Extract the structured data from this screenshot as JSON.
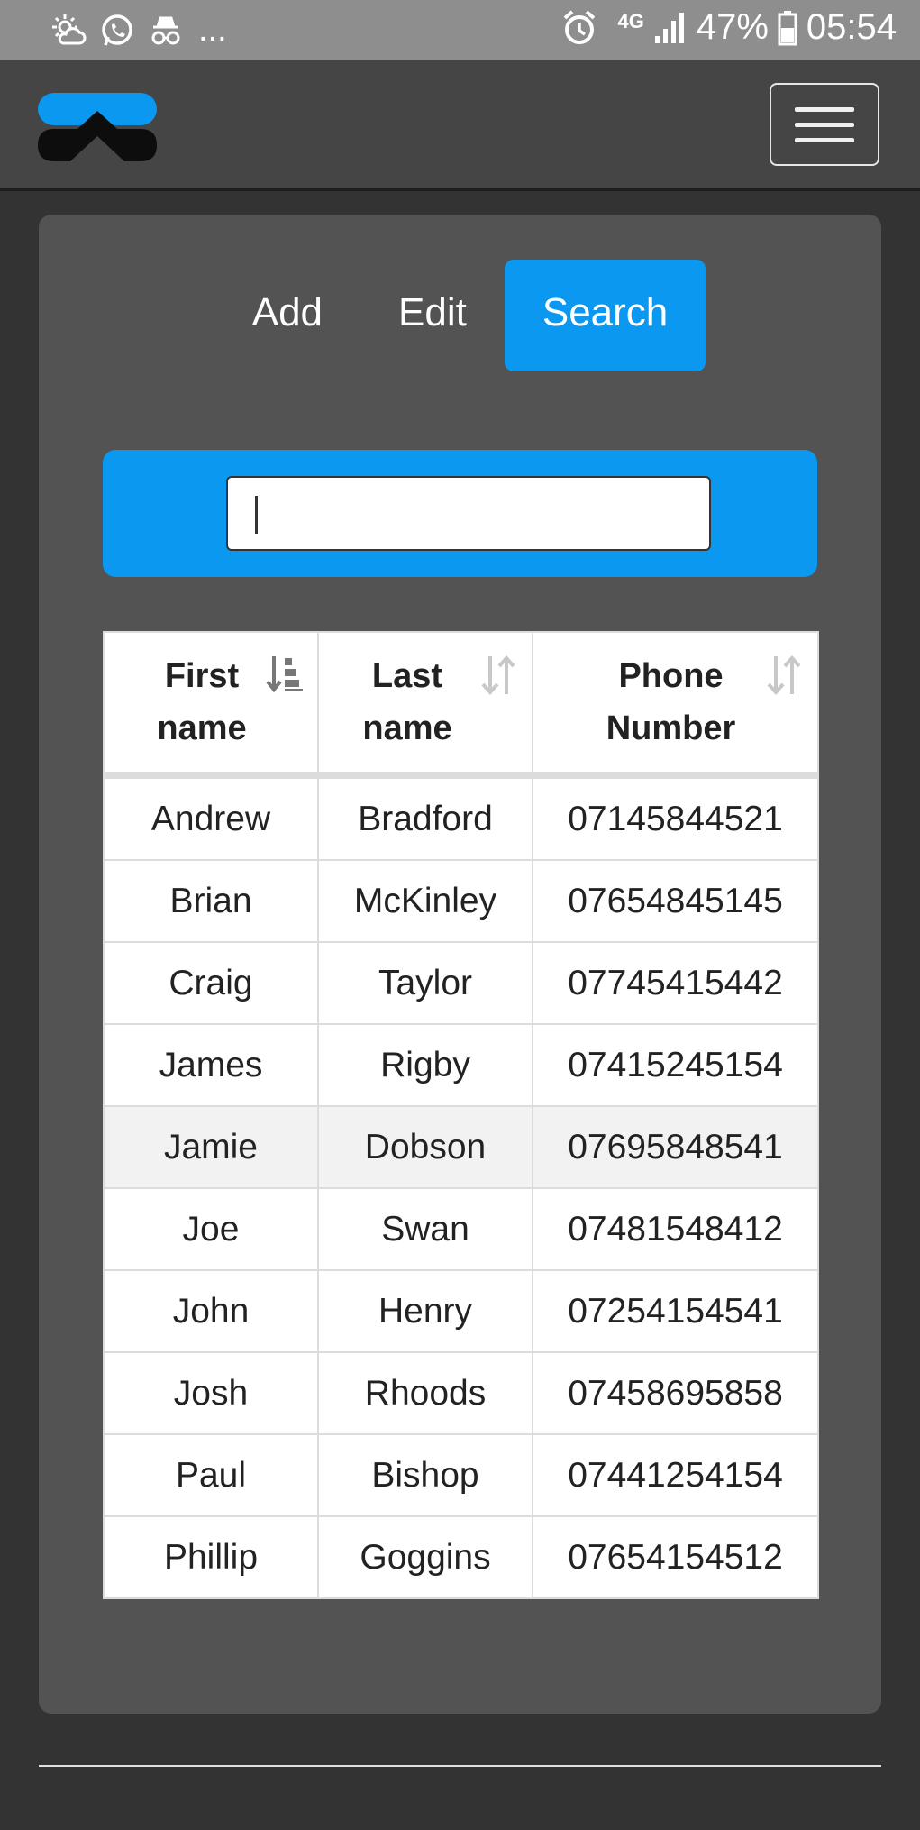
{
  "status_bar": {
    "icons_left": [
      "sun-cloud-icon",
      "whatsapp-icon",
      "incognito-icon"
    ],
    "overflow": "...",
    "network": "4G",
    "battery_percent": "47%",
    "time": "05:54"
  },
  "tabs": [
    {
      "label": "Add",
      "active": false
    },
    {
      "label": "Edit",
      "active": false
    },
    {
      "label": "Search",
      "active": true
    }
  ],
  "search": {
    "value": "",
    "placeholder": ""
  },
  "table": {
    "columns": [
      {
        "label_line1": "First",
        "label_line2": "name",
        "sort": "ascending"
      },
      {
        "label_line1": "Last",
        "label_line2": "name",
        "sort": "none"
      },
      {
        "label_line1": "Phone",
        "label_line2": "Number",
        "sort": "none"
      }
    ],
    "rows": [
      [
        "Andrew",
        "Bradford",
        "07145844521"
      ],
      [
        "Brian",
        "McKinley",
        "07654845145"
      ],
      [
        "Craig",
        "Taylor",
        "07745415442"
      ],
      [
        "James",
        "Rigby",
        "07415245154"
      ],
      [
        "Jamie",
        "Dobson",
        "07695848541"
      ],
      [
        "Joe",
        "Swan",
        "07481548412"
      ],
      [
        "John",
        "Henry",
        "07254154541"
      ],
      [
        "Josh",
        "Rhoods",
        "07458695858"
      ],
      [
        "Paul",
        "Bishop",
        "07441254154"
      ],
      [
        "Phillip",
        "Goggins",
        "07654154512"
      ]
    ],
    "highlighted_row": 4
  },
  "colors": {
    "accent": "#0a98f0",
    "background": "#333333",
    "card": "#535353",
    "navbar": "#454545"
  }
}
